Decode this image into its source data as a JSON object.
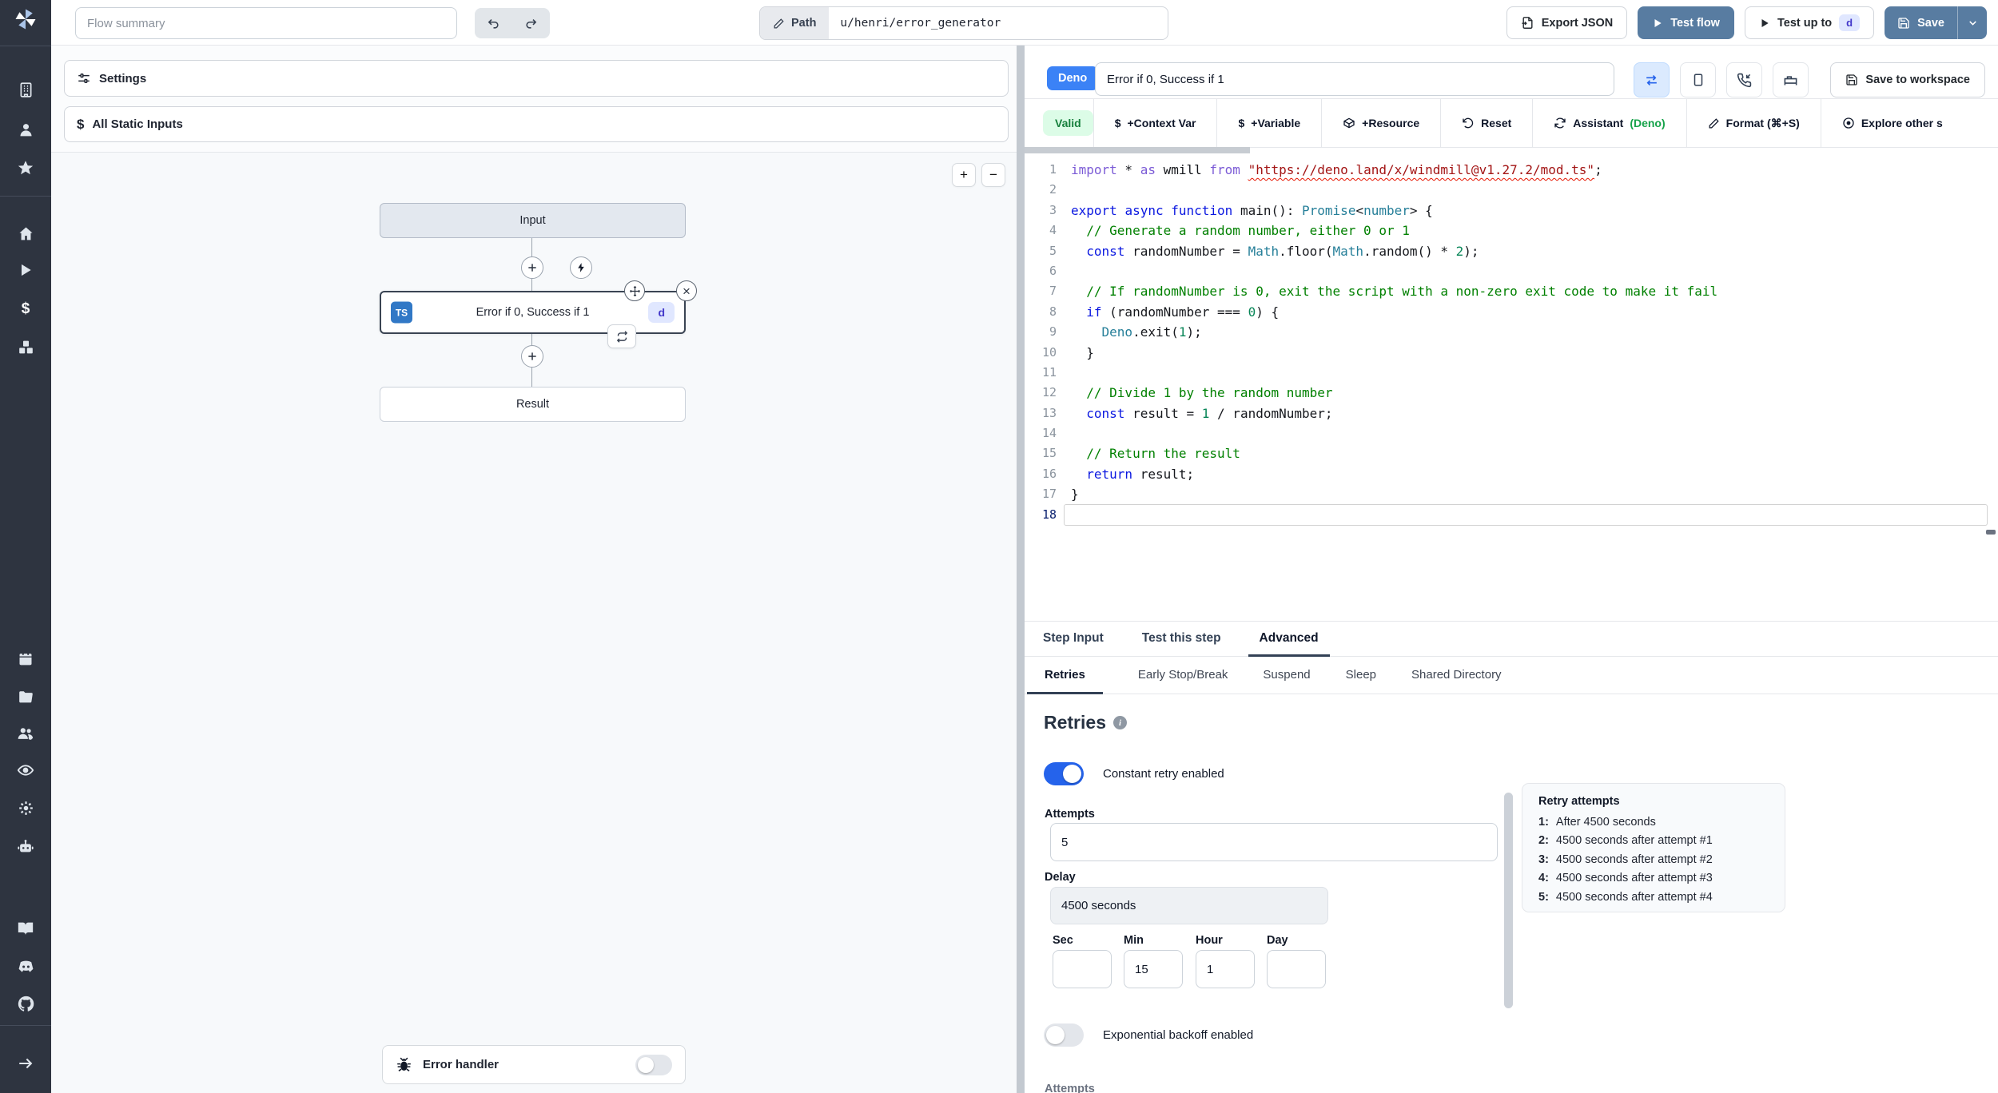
{
  "topbar": {
    "flow_summary_placeholder": "Flow summary",
    "path_label": "Path",
    "path_value": "u/henri/error_generator",
    "export_json_label": "Export JSON",
    "test_flow_label": "Test flow",
    "test_up_to_label": "Test up to",
    "test_up_to_badge": "d",
    "save_label": "Save"
  },
  "left_panel": {
    "settings_label": "Settings",
    "static_inputs_label": "All Static Inputs",
    "zoom_in": "+",
    "zoom_out": "−",
    "graph": {
      "input_label": "Input",
      "step_lang_badge": "TS",
      "step_label": "Error if 0, Success if 1",
      "step_id_badge": "d",
      "result_label": "Result"
    },
    "error_handler_label": "Error handler"
  },
  "editor_panel": {
    "lang_badge": "Deno",
    "step_name": "Error if 0, Success if 1",
    "save_to_workspace_label": "Save to workspace",
    "toolbar": {
      "valid_label": "Valid",
      "context_var_label": "+Context Var",
      "variable_label": "+Variable",
      "resource_label": "+Resource",
      "reset_label": "Reset",
      "assistant_label": "Assistant",
      "assistant_lang": "(Deno)",
      "format_label": "Format (⌘+S)",
      "explore_label": "Explore other s"
    },
    "code": {
      "lines": [
        {
          "n": 1,
          "tokens": [
            {
              "c": "p",
              "t": "import"
            },
            {
              "c": "d",
              "t": " * "
            },
            {
              "c": "p",
              "t": "as"
            },
            {
              "c": "d",
              "t": " wmill "
            },
            {
              "c": "p",
              "t": "from"
            },
            {
              "c": "d",
              "t": " "
            },
            {
              "c": "s",
              "t": "\"https://deno.land/x/windmill@v1.27.2/mod.ts\"",
              "sq": true
            },
            {
              "c": "d",
              "t": ";"
            }
          ]
        },
        {
          "n": 2,
          "tokens": []
        },
        {
          "n": 3,
          "tokens": [
            {
              "c": "k",
              "t": "export"
            },
            {
              "c": "d",
              "t": " "
            },
            {
              "c": "k",
              "t": "async"
            },
            {
              "c": "d",
              "t": " "
            },
            {
              "c": "k",
              "t": "function"
            },
            {
              "c": "d",
              "t": " main(): "
            },
            {
              "c": "t",
              "t": "Promise"
            },
            {
              "c": "d",
              "t": "<"
            },
            {
              "c": "t",
              "t": "number"
            },
            {
              "c": "d",
              "t": "> {"
            }
          ]
        },
        {
          "n": 4,
          "tokens": [
            {
              "c": "c",
              "t": "  // Generate a random number, either 0 or 1"
            }
          ]
        },
        {
          "n": 5,
          "tokens": [
            {
              "c": "d",
              "t": "  "
            },
            {
              "c": "k",
              "t": "const"
            },
            {
              "c": "d",
              "t": " randomNumber = "
            },
            {
              "c": "t",
              "t": "Math"
            },
            {
              "c": "d",
              "t": ".floor("
            },
            {
              "c": "t",
              "t": "Math"
            },
            {
              "c": "d",
              "t": ".random() * "
            },
            {
              "c": "n",
              "t": "2"
            },
            {
              "c": "d",
              "t": ");"
            }
          ]
        },
        {
          "n": 6,
          "tokens": []
        },
        {
          "n": 7,
          "tokens": [
            {
              "c": "c",
              "t": "  // If randomNumber is 0, exit the script with a non-zero exit code to make it fail"
            }
          ]
        },
        {
          "n": 8,
          "tokens": [
            {
              "c": "d",
              "t": "  "
            },
            {
              "c": "k",
              "t": "if"
            },
            {
              "c": "d",
              "t": " (randomNumber === "
            },
            {
              "c": "n",
              "t": "0"
            },
            {
              "c": "d",
              "t": ") {"
            }
          ]
        },
        {
          "n": 9,
          "tokens": [
            {
              "c": "d",
              "t": "    "
            },
            {
              "c": "t",
              "t": "Deno"
            },
            {
              "c": "d",
              "t": ".exit("
            },
            {
              "c": "n",
              "t": "1"
            },
            {
              "c": "d",
              "t": ");"
            }
          ]
        },
        {
          "n": 10,
          "tokens": [
            {
              "c": "d",
              "t": "  }"
            }
          ]
        },
        {
          "n": 11,
          "tokens": []
        },
        {
          "n": 12,
          "tokens": [
            {
              "c": "c",
              "t": "  // Divide 1 by the random number"
            }
          ]
        },
        {
          "n": 13,
          "tokens": [
            {
              "c": "d",
              "t": "  "
            },
            {
              "c": "k",
              "t": "const"
            },
            {
              "c": "d",
              "t": " result = "
            },
            {
              "c": "n",
              "t": "1"
            },
            {
              "c": "d",
              "t": " / randomNumber;"
            }
          ]
        },
        {
          "n": 14,
          "tokens": []
        },
        {
          "n": 15,
          "tokens": [
            {
              "c": "c",
              "t": "  // Return the result"
            }
          ]
        },
        {
          "n": 16,
          "tokens": [
            {
              "c": "d",
              "t": "  "
            },
            {
              "c": "k",
              "t": "return"
            },
            {
              "c": "d",
              "t": " result;"
            }
          ]
        },
        {
          "n": 17,
          "tokens": [
            {
              "c": "d",
              "t": "}"
            }
          ]
        },
        {
          "n": 18,
          "tokens": [],
          "active": true
        }
      ]
    }
  },
  "tabs": {
    "items": [
      "Step Input",
      "Test this step",
      "Advanced"
    ],
    "active": "Advanced"
  },
  "subtabs": {
    "items": [
      "Retries",
      "Early Stop/Break",
      "Suspend",
      "Sleep",
      "Shared Directory"
    ],
    "active": "Retries"
  },
  "retries": {
    "title": "Retries",
    "constant_label": "Constant retry enabled",
    "constant_enabled": true,
    "attempts_label": "Attempts",
    "attempts_value": "5",
    "delay_label": "Delay",
    "delay_value": "4500 seconds",
    "time_fields": [
      {
        "label": "Sec",
        "value": ""
      },
      {
        "label": "Min",
        "value": "15"
      },
      {
        "label": "Hour",
        "value": "1"
      },
      {
        "label": "Day",
        "value": ""
      }
    ],
    "exponential_label": "Exponential backoff enabled",
    "exponential_enabled": false,
    "next_label_partial": "Attempts",
    "preview": {
      "title": "Retry attempts",
      "items": [
        {
          "n": "1:",
          "text": "After 4500 seconds"
        },
        {
          "n": "2:",
          "text": "4500 seconds after attempt #1"
        },
        {
          "n": "3:",
          "text": "4500 seconds after attempt #2"
        },
        {
          "n": "4:",
          "text": "4500 seconds after attempt #3"
        },
        {
          "n": "5:",
          "text": "4500 seconds after attempt #4"
        }
      ]
    }
  },
  "colors": {
    "primary_button": "#587ca1",
    "deno_badge": "#3b82f6",
    "ts_badge": "#3178c6",
    "valid_bg": "#dcfce7",
    "valid_text": "#17803d",
    "toggle_on": "#2563eb",
    "sidebar_bg": "#2e3440"
  }
}
